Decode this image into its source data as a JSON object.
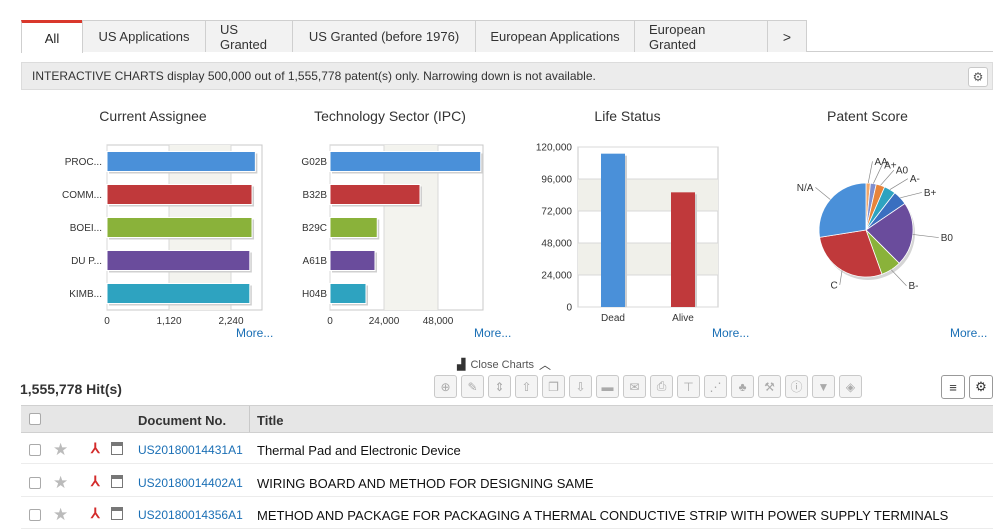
{
  "tabs": [
    {
      "label": "All",
      "active": true
    },
    {
      "label": "US Applications"
    },
    {
      "label": "US Granted"
    },
    {
      "label": "US Granted (before 1976)"
    },
    {
      "label": "European Applications"
    },
    {
      "label": "European Granted"
    },
    {
      "label": ">"
    }
  ],
  "notice": "INTERACTIVE CHARTS display 500,000 out of 1,555,778 patent(s) only. Narrowing down is not available.",
  "more_label": "More...",
  "charts": {
    "assignee": {
      "title": "Current Assignee"
    },
    "sector": {
      "title": "Technology Sector (IPC)"
    },
    "life": {
      "title": "Life Status"
    },
    "score": {
      "title": "Patent Score"
    }
  },
  "chart_data": [
    {
      "type": "bar",
      "orientation": "horizontal",
      "title": "Current Assignee",
      "categories": [
        "PROC...",
        "COMM...",
        "BOEI...",
        "DU P...",
        "KIMB..."
      ],
      "values": [
        2680,
        2620,
        2620,
        2580,
        2580
      ],
      "colors": [
        "#4a90d9",
        "#c0393b",
        "#8ab23a",
        "#6a4c9c",
        "#2ea3c0"
      ],
      "xticks": [
        "0",
        "1,120",
        "2,240"
      ],
      "xlim": [
        0,
        2800
      ]
    },
    {
      "type": "bar",
      "orientation": "horizontal",
      "title": "Technology Sector (IPC)",
      "categories": [
        "G02B",
        "B32B",
        "B29C",
        "A61B",
        "H04B"
      ],
      "values": [
        67000,
        40000,
        21000,
        20000,
        16000
      ],
      "colors": [
        "#4a90d9",
        "#c0393b",
        "#8ab23a",
        "#6a4c9c",
        "#2ea3c0"
      ],
      "xticks": [
        "0",
        "24,000",
        "48,000"
      ],
      "xlim": [
        0,
        68000
      ]
    },
    {
      "type": "bar",
      "title": "Life Status",
      "categories": [
        "Dead",
        "Alive"
      ],
      "values": [
        115000,
        86000
      ],
      "colors": [
        "#4a90d9",
        "#c0393b"
      ],
      "yticks": [
        "120,000",
        "96,000",
        "72,000",
        "48,000",
        "24,000",
        "0"
      ],
      "ylim": [
        0,
        120000
      ]
    },
    {
      "type": "pie",
      "title": "Patent Score",
      "labels": [
        "AA",
        "A+",
        "A0",
        "A-",
        "B+",
        "B0",
        "B-",
        "C",
        "N/A"
      ],
      "values": [
        1.5,
        2,
        3,
        4,
        5,
        22,
        7,
        28,
        27.5
      ],
      "colors": [
        "#f2a76a",
        "#7f8fcf",
        "#e8843a",
        "#2ea3c0",
        "#3a6fc0",
        "#6a4c9c",
        "#8ab23a",
        "#c0393b",
        "#4a90d9"
      ]
    }
  ],
  "close_charts": "Close Charts",
  "hits": "1,555,778 Hit(s)",
  "table": {
    "col_doc": "Document No.",
    "col_title": "Title",
    "rows": [
      {
        "doc": "US20180014431A1",
        "title": "Thermal Pad and Electronic Device"
      },
      {
        "doc": "US20180014402A1",
        "title": "WIRING BOARD AND METHOD FOR DESIGNING SAME"
      },
      {
        "doc": "US20180014356A1",
        "title": "METHOD AND PACKAGE FOR PACKAGING A THERMAL CONDUCTIVE STRIP WITH POWER SUPPLY TERMINALS"
      }
    ]
  },
  "icons": {
    "toolbar": [
      "globe-icon",
      "edit-icon",
      "sort-icon",
      "upload-icon",
      "copy-icon",
      "download-icon",
      "folder-icon",
      "email-icon",
      "print-icon",
      "hierarchy-icon",
      "network-icon",
      "tree-icon",
      "hammer-icon",
      "info-icon",
      "filter-icon",
      "layers-icon"
    ]
  }
}
